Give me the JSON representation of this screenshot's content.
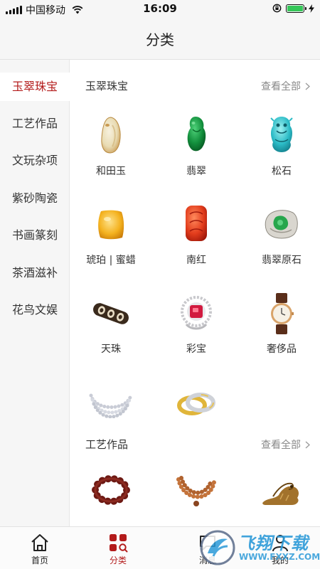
{
  "status_bar": {
    "carrier": "中国移动",
    "time": "16:09"
  },
  "nav": {
    "title": "分类"
  },
  "sidebar": {
    "items": [
      {
        "label": "玉翠珠宝",
        "active": true
      },
      {
        "label": "工艺作品"
      },
      {
        "label": "文玩杂项"
      },
      {
        "label": "紫砂陶瓷"
      },
      {
        "label": "书画篆刻"
      },
      {
        "label": "茶酒滋补"
      },
      {
        "label": "花鸟文娱"
      }
    ]
  },
  "sections": [
    {
      "title": "玉翠珠宝",
      "see_all": "查看全部",
      "items": [
        {
          "label": "和田玉",
          "icon": "hetian-jade-pendant-icon"
        },
        {
          "label": "翡翠",
          "icon": "jadeite-carving-icon"
        },
        {
          "label": "松石",
          "icon": "turquoise-carving-icon"
        },
        {
          "label": "琥珀 | 蜜蜡",
          "icon": "amber-beeswax-icon"
        },
        {
          "label": "南红",
          "icon": "southern-red-agate-icon"
        },
        {
          "label": "翡翠原石",
          "icon": "rough-jadeite-stone-icon"
        },
        {
          "label": "天珠",
          "icon": "dzi-bead-icon"
        },
        {
          "label": "彩宝",
          "icon": "gemstone-ring-icon"
        },
        {
          "label": "奢侈品",
          "icon": "luxury-watch-icon"
        },
        {
          "label": "",
          "icon": "pearl-necklace-icon"
        },
        {
          "label": "",
          "icon": "gold-rings-icon"
        }
      ]
    },
    {
      "title": "工艺作品",
      "see_all": "查看全部",
      "items": [
        {
          "label": "",
          "icon": "bead-bracelet-icon"
        },
        {
          "label": "",
          "icon": "wood-prayer-beads-icon"
        },
        {
          "label": "",
          "icon": "carved-sculpture-icon"
        }
      ]
    }
  ],
  "tab_bar": {
    "items": [
      {
        "label": "首页",
        "icon": "home-icon"
      },
      {
        "label": "分类",
        "icon": "category-icon",
        "active": true
      },
      {
        "label": "消息",
        "icon": "message-icon"
      },
      {
        "label": "我的",
        "icon": "profile-icon"
      }
    ]
  },
  "watermark": {
    "text": "飞翔下载",
    "url": "WWW.FXXZ.COM"
  },
  "colors": {
    "accent": "#b31b1b",
    "sidebar_bg": "#f6f6f6",
    "muted": "#888888"
  }
}
